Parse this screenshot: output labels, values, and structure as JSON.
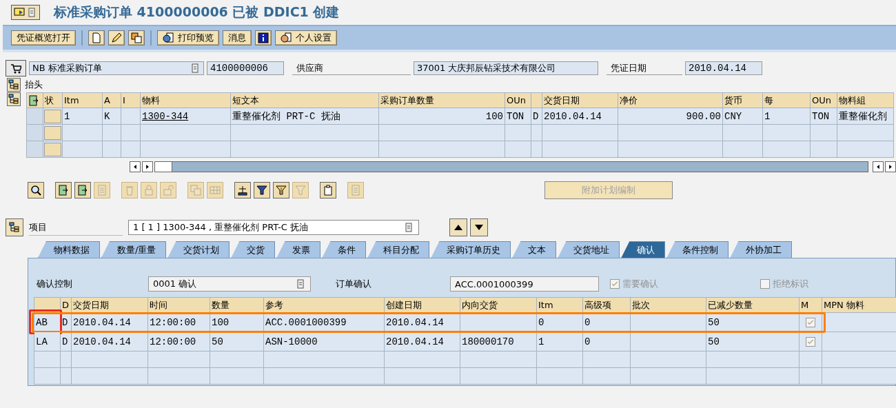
{
  "title": "标准采购订单 4100000006 已被 DDIC1 创建",
  "toolbar": [
    {
      "kind": "text",
      "label": "凭证概览打开"
    },
    {
      "kind": "separator"
    },
    {
      "kind": "icon"
    },
    {
      "kind": "icon"
    },
    {
      "kind": "icon"
    },
    {
      "kind": "separator"
    },
    {
      "kind": "icon_text",
      "label": "打印预览"
    },
    {
      "kind": "text",
      "label": "消息"
    },
    {
      "kind": "icon"
    },
    {
      "kind": "icon_text",
      "label": "个人设置"
    }
  ],
  "header": {
    "doc_type": "NB 标准采购订单",
    "doc_number": "4100000006",
    "vendor_label": "供应商",
    "vendor": "37001 大庆邦辰钻采技术有限公司",
    "date_label": "凭证日期",
    "date": "2010.04.14"
  },
  "section_label": "抬头",
  "items_table": {
    "columns": [
      {
        "label": "状",
        "kind": "status"
      },
      {
        "label": "Itm",
        "kind": "text"
      },
      {
        "label": "A",
        "kind": "text"
      },
      {
        "label": "I",
        "kind": "text"
      },
      {
        "label": "物料",
        "kind": "link"
      },
      {
        "label": "短文本",
        "kind": "text"
      },
      {
        "label": "采购订单数量",
        "kind": "number"
      },
      {
        "label": "OUn",
        "kind": "text"
      },
      {
        "kind": "text"
      },
      {
        "label": "交货日期",
        "kind": "text"
      },
      {
        "label": "净价",
        "kind": "number"
      },
      {
        "label": "货币",
        "kind": "text"
      },
      {
        "label": "每",
        "kind": "text"
      },
      {
        "label": "OUn",
        "kind": "text"
      },
      {
        "label": "物料組",
        "kind": "text"
      }
    ],
    "rows": [
      {
        "cells": [
          {},
          {
            "text": "1"
          },
          {
            "text": "K"
          },
          {},
          {
            "text": "1300-344"
          },
          {
            "text": "重整催化剂 PRT-C 抚油"
          },
          {
            "text": "100"
          },
          {
            "text": "TON"
          },
          {
            "text": "D"
          },
          {
            "text": "2010.04.14"
          },
          {
            "text": "900.00"
          },
          {
            "text": "CNY"
          },
          {
            "text": "1"
          },
          {
            "text": "TON"
          },
          {
            "text": "重整催化剂"
          }
        ]
      }
    ]
  },
  "table_tools": [
    {
      "kind": "tool",
      "disabled": false
    },
    {
      "kind": "gap"
    },
    {
      "kind": "tool",
      "disabled": false
    },
    {
      "kind": "tool",
      "disabled": false
    },
    {
      "kind": "tool",
      "disabled": true
    },
    {
      "kind": "gap"
    },
    {
      "kind": "tool",
      "disabled": true
    },
    {
      "kind": "tool",
      "disabled": true
    },
    {
      "kind": "tool",
      "disabled": true
    },
    {
      "kind": "gap"
    },
    {
      "kind": "tool",
      "disabled": true
    },
    {
      "kind": "tool",
      "disabled": true
    },
    {
      "kind": "gap"
    },
    {
      "kind": "tool",
      "disabled": false
    },
    {
      "kind": "tool",
      "disabled": false
    },
    {
      "kind": "tool",
      "disabled": false
    },
    {
      "kind": "tool",
      "disabled": true
    },
    {
      "kind": "gap"
    },
    {
      "kind": "tool",
      "disabled": false
    },
    {
      "kind": "gap"
    },
    {
      "kind": "tool",
      "disabled": true
    }
  ],
  "schedule_button": {
    "label": "附加计划编制",
    "disabled": true
  },
  "item_selector": {
    "label": "项目",
    "value": "1 [ 1 ] 1300-344 , 重整催化剂 PRT-C 抚油"
  },
  "tabs": [
    {
      "label": "物料数据",
      "selected": false
    },
    {
      "label": "数量/重量",
      "selected": false
    },
    {
      "label": "交货计划",
      "selected": false
    },
    {
      "label": "交货",
      "selected": false
    },
    {
      "label": "发票",
      "selected": false
    },
    {
      "label": "条件",
      "selected": false
    },
    {
      "label": "科目分配",
      "selected": false
    },
    {
      "label": "采购订单历史",
      "selected": false
    },
    {
      "label": "文本",
      "selected": false
    },
    {
      "label": "交货地址",
      "selected": false
    },
    {
      "label": "确认",
      "selected": true
    },
    {
      "label": "条件控制",
      "selected": false
    },
    {
      "label": "外协加工",
      "selected": false
    }
  ],
  "confirmation": {
    "control_label": "确认控制",
    "control_value": "0001 确认",
    "order_conf_label": "订单确认",
    "order_conf_value": "ACC.0001000399",
    "checkboxes": [
      {
        "label": "需要确认",
        "checked": true
      },
      {
        "label": "拒绝标识",
        "checked": false
      }
    ],
    "table": {
      "columns": [
        {
          "kind": "text"
        },
        {
          "label": "D",
          "kind": "text"
        },
        {
          "label": "交货日期",
          "kind": "text"
        },
        {
          "label": "时间",
          "kind": "text"
        },
        {
          "label": "数量",
          "kind": "text"
        },
        {
          "label": "参考",
          "kind": "text"
        },
        {
          "label": "创建日期",
          "kind": "text"
        },
        {
          "label": "内向交货",
          "kind": "text"
        },
        {
          "label": "Itm",
          "kind": "text"
        },
        {
          "label": "高级项",
          "kind": "text"
        },
        {
          "label": "批次",
          "kind": "text"
        },
        {
          "label": "已减少数量",
          "kind": "text"
        },
        {
          "label": "M",
          "kind": "checkbox"
        },
        {
          "label": "MPN 物料",
          "kind": "text"
        }
      ],
      "rows": [
        {
          "outlined": true,
          "first_cell_outlined": true,
          "cells": [
            {
              "text": "AB"
            },
            {
              "text": "D"
            },
            {
              "text": "2010.04.14"
            },
            {
              "text": "12:00:00"
            },
            {
              "text": "100"
            },
            {
              "text": "ACC.0001000399"
            },
            {
              "text": "2010.04.14"
            },
            {},
            {
              "text": "0"
            },
            {
              "text": "0"
            },
            {},
            {
              "text": "50"
            },
            {
              "checked": true
            },
            {}
          ]
        },
        {
          "outlined": false,
          "first_cell_outlined": false,
          "cells": [
            {
              "text": "LA"
            },
            {
              "text": "D"
            },
            {
              "text": "2010.04.14"
            },
            {
              "text": "12:00:00"
            },
            {
              "text": "50"
            },
            {
              "text": "ASN-10000"
            },
            {
              "text": "2010.04.14"
            },
            {
              "text": "180000170"
            },
            {
              "text": "1"
            },
            {
              "text": "0"
            },
            {},
            {
              "text": "50"
            },
            {
              "checked": true
            },
            {}
          ]
        }
      ]
    }
  }
}
